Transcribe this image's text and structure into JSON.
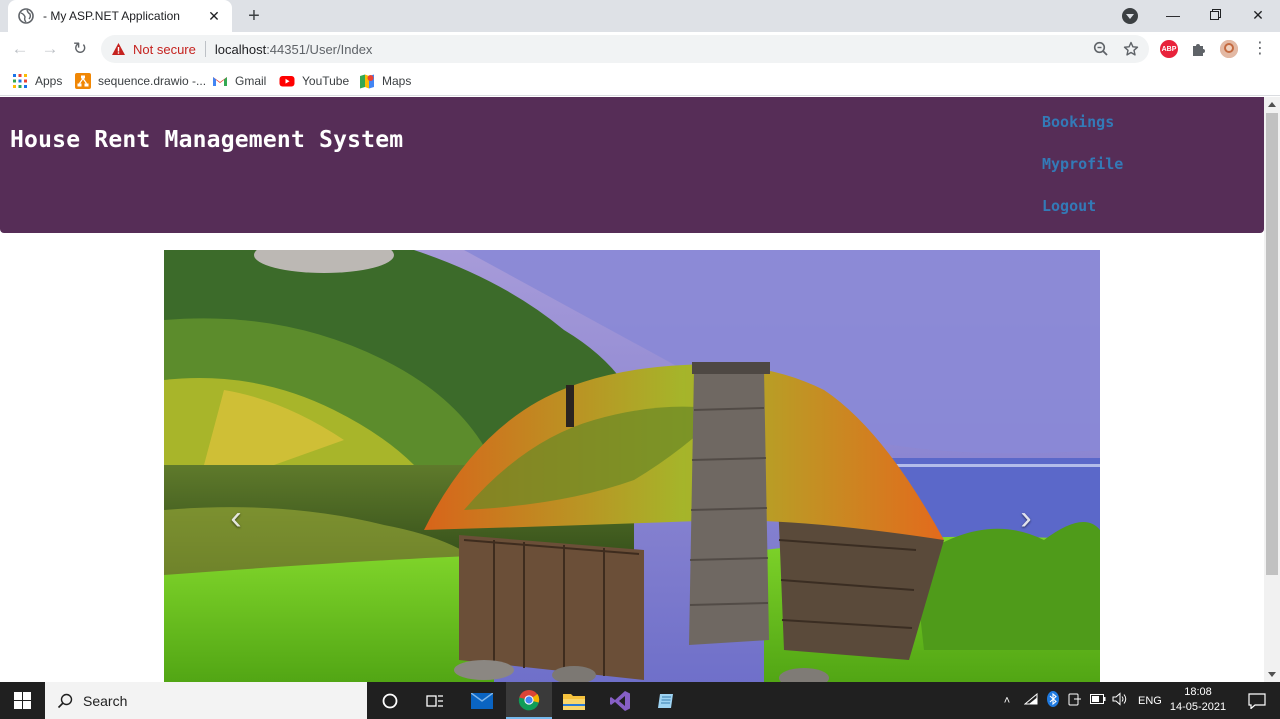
{
  "browser": {
    "tab_title": "- My ASP.NET Application",
    "tab_close": "✕",
    "new_tab": "+",
    "security_label": "Not secure",
    "url_host": "localhost",
    "url_rest": ":44351/User/Index",
    "bookmarks": [
      "Apps",
      "sequence.drawio -...",
      "Gmail",
      "YouTube",
      "Maps"
    ],
    "extensions": {
      "abp_label": "ABP"
    }
  },
  "site": {
    "title": "House Rent Management System",
    "nav": [
      "Bookings",
      "Myprofile",
      "Logout"
    ],
    "carousel": {
      "prev_glyph": "‹",
      "next_glyph": "›"
    }
  },
  "taskbar": {
    "search_label": "Search",
    "language": "ENG",
    "time": "18:08",
    "date": "14-05-2021"
  },
  "colors": {
    "header_bg": "#562d57",
    "nav_link": "#337ab7",
    "security_red": "#c5221f"
  }
}
